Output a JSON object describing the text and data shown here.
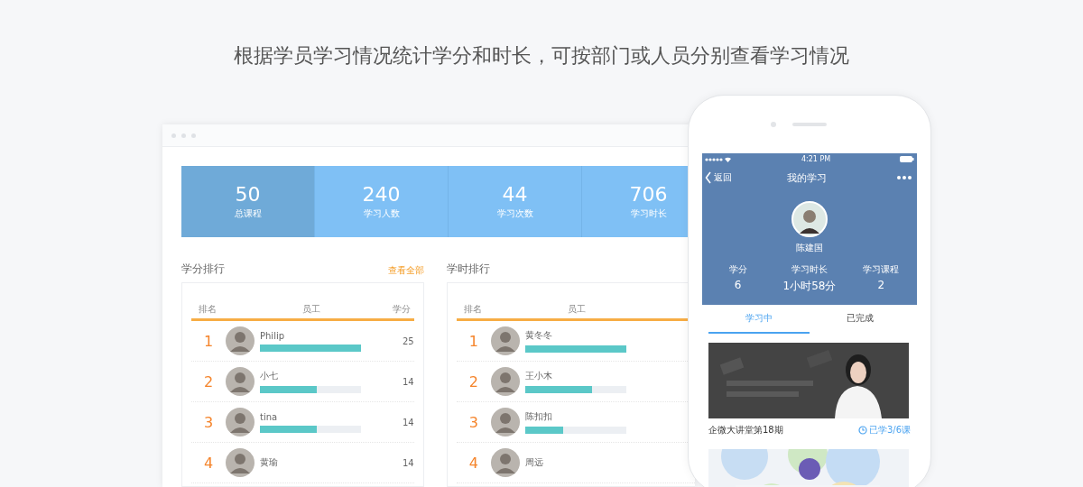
{
  "headline": "根据学员学习情况统计学分和时长，可按部门或人员分别查看学习情况",
  "stats": [
    {
      "value": "50",
      "label": "总课程",
      "selected": true
    },
    {
      "value": "240",
      "label": "学习人数",
      "selected": false
    },
    {
      "value": "44",
      "label": "学习次数",
      "selected": false
    },
    {
      "value": "706",
      "label": "学习时长",
      "selected": false
    }
  ],
  "panels": [
    {
      "title": "学分排行",
      "link": "查看全部",
      "columns": [
        "排名",
        "员工",
        "学分"
      ],
      "rows": [
        {
          "rank": "1",
          "name": "Philip",
          "level": 1,
          "score": "25"
        },
        {
          "rank": "2",
          "name": "小七",
          "level": 0.56,
          "score": "14"
        },
        {
          "rank": "3",
          "name": "tina",
          "level": 0.56,
          "score": "14"
        },
        {
          "rank": "4",
          "name": "黄瑜",
          "score": "14"
        }
      ]
    },
    {
      "title": "学时排行",
      "columns": [
        "排名",
        "员工"
      ],
      "rows": [
        {
          "rank": "1",
          "name": "黄冬冬",
          "level": 1
        },
        {
          "rank": "2",
          "name": "王小木",
          "level": 0.66
        },
        {
          "rank": "3",
          "name": "陈扣扣",
          "level": 0.38
        },
        {
          "rank": "4",
          "name": "周远"
        }
      ]
    }
  ],
  "phone": {
    "time": "4:21 PM",
    "back": "返回",
    "title": "我的学习",
    "user": "陈建国",
    "stats": [
      {
        "label": "学分",
        "value": "6"
      },
      {
        "label": "学习时长",
        "value": "1小时58分"
      },
      {
        "label": "学习课程",
        "value": "2"
      }
    ],
    "tabs": [
      {
        "label": "学习中",
        "selected": true
      },
      {
        "label": "已完成",
        "selected": false
      }
    ],
    "courses": [
      {
        "kind": "picture",
        "title": "企微大讲堂第18期",
        "progress": "已学3/6课"
      },
      {
        "kind": "picture"
      }
    ]
  }
}
